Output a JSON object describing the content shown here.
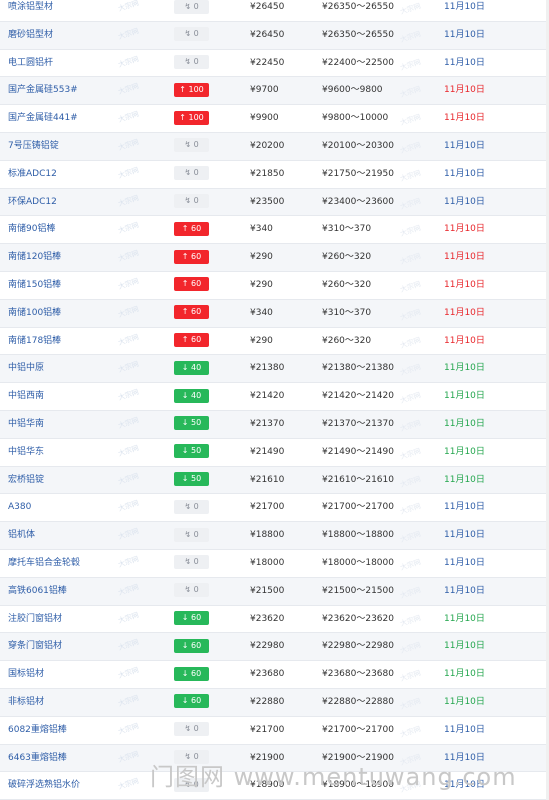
{
  "rows": [
    {
      "name": "喷涂铝型材",
      "change": "0",
      "dir": "flat",
      "price": "¥26450",
      "range": "¥26350～26550",
      "date": "11月10日"
    },
    {
      "name": "磨砂铝型材",
      "change": "0",
      "dir": "flat",
      "price": "¥26450",
      "range": "¥26350～26550",
      "date": "11月10日"
    },
    {
      "name": "电工圆铝杆",
      "change": "0",
      "dir": "flat",
      "price": "¥22450",
      "range": "¥22400～22500",
      "date": "11月10日"
    },
    {
      "name": "国产金属硅553#",
      "change": "100",
      "dir": "up",
      "price": "¥9700",
      "range": "¥9600～9800",
      "date": "11月10日"
    },
    {
      "name": "国产金属硅441#",
      "change": "100",
      "dir": "up",
      "price": "¥9900",
      "range": "¥9800～10000",
      "date": "11月10日"
    },
    {
      "name": "7号压铸铝锭",
      "change": "0",
      "dir": "flat",
      "price": "¥20200",
      "range": "¥20100～20300",
      "date": "11月10日"
    },
    {
      "name": "标准ADC12",
      "change": "0",
      "dir": "flat",
      "price": "¥21850",
      "range": "¥21750～21950",
      "date": "11月10日"
    },
    {
      "name": "环保ADC12",
      "change": "0",
      "dir": "flat",
      "price": "¥23500",
      "range": "¥23400～23600",
      "date": "11月10日"
    },
    {
      "name": "南储90铝棒",
      "change": "60",
      "dir": "up",
      "price": "¥340",
      "range": "¥310～370",
      "date": "11月10日"
    },
    {
      "name": "南储120铝棒",
      "change": "60",
      "dir": "up",
      "price": "¥290",
      "range": "¥260～320",
      "date": "11月10日"
    },
    {
      "name": "南储150铝棒",
      "change": "60",
      "dir": "up",
      "price": "¥290",
      "range": "¥260～320",
      "date": "11月10日"
    },
    {
      "name": "南储100铝棒",
      "change": "60",
      "dir": "up",
      "price": "¥340",
      "range": "¥310～370",
      "date": "11月10日"
    },
    {
      "name": "南储178铝棒",
      "change": "60",
      "dir": "up",
      "price": "¥290",
      "range": "¥260～320",
      "date": "11月10日"
    },
    {
      "name": "中铝中原",
      "change": "40",
      "dir": "down",
      "price": "¥21380",
      "range": "¥21380～21380",
      "date": "11月10日"
    },
    {
      "name": "中铝西南",
      "change": "40",
      "dir": "down",
      "price": "¥21420",
      "range": "¥21420～21420",
      "date": "11月10日"
    },
    {
      "name": "中铝华南",
      "change": "50",
      "dir": "down",
      "price": "¥21370",
      "range": "¥21370～21370",
      "date": "11月10日"
    },
    {
      "name": "中铝华东",
      "change": "50",
      "dir": "down",
      "price": "¥21490",
      "range": "¥21490～21490",
      "date": "11月10日"
    },
    {
      "name": "宏桥铝锭",
      "change": "50",
      "dir": "down",
      "price": "¥21610",
      "range": "¥21610～21610",
      "date": "11月10日"
    },
    {
      "name": "A380",
      "change": "0",
      "dir": "flat",
      "price": "¥21700",
      "range": "¥21700～21700",
      "date": "11月10日"
    },
    {
      "name": "铝机体",
      "change": "0",
      "dir": "flat",
      "price": "¥18800",
      "range": "¥18800～18800",
      "date": "11月10日"
    },
    {
      "name": "摩托车铝合金轮毂",
      "change": "0",
      "dir": "flat",
      "price": "¥18000",
      "range": "¥18000～18000",
      "date": "11月10日"
    },
    {
      "name": "高铁6061铝棒",
      "change": "0",
      "dir": "flat",
      "price": "¥21500",
      "range": "¥21500～21500",
      "date": "11月10日"
    },
    {
      "name": "注胶门窗铝材",
      "change": "60",
      "dir": "down",
      "price": "¥23620",
      "range": "¥23620～23620",
      "date": "11月10日"
    },
    {
      "name": "穿条门窗铝材",
      "change": "60",
      "dir": "down",
      "price": "¥22980",
      "range": "¥22980～22980",
      "date": "11月10日"
    },
    {
      "name": "国标铝材",
      "change": "60",
      "dir": "down",
      "price": "¥23680",
      "range": "¥23680～23680",
      "date": "11月10日"
    },
    {
      "name": "非标铝材",
      "change": "60",
      "dir": "down",
      "price": "¥22880",
      "range": "¥22880～22880",
      "date": "11月10日"
    },
    {
      "name": "6082重熔铝棒",
      "change": "0",
      "dir": "flat",
      "price": "¥21700",
      "range": "¥21700～21700",
      "date": "11月10日"
    },
    {
      "name": "6463重熔铝棒",
      "change": "0",
      "dir": "flat",
      "price": "¥21900",
      "range": "¥21900～21900",
      "date": "11月10日"
    },
    {
      "name": "破碎浮选熟铝水价",
      "change": "0",
      "dir": "flat",
      "price": "¥18900",
      "range": "¥18900～18900",
      "date": "11月10日"
    }
  ],
  "arrows": {
    "flat": "↯",
    "up": "↑",
    "down": "↓"
  },
  "watermark_mini": "大宗网",
  "watermark": "门图网 www.mentuwang.com"
}
